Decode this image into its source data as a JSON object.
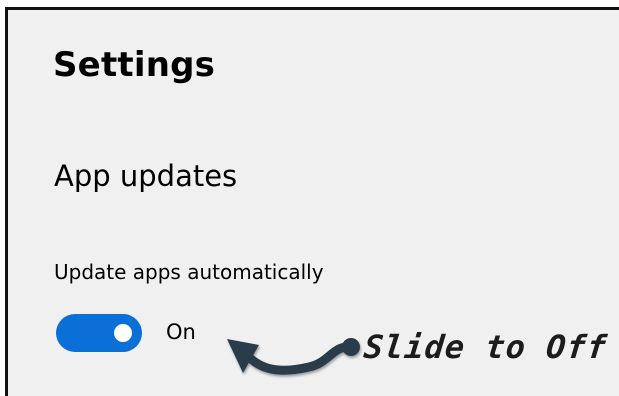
{
  "settings": {
    "title": "Settings"
  },
  "app_updates": {
    "section_title": "App updates",
    "auto_update_label": "Update apps automatically",
    "toggle_state": "On",
    "toggle_on": true,
    "toggle_color": "#0a6fd6"
  },
  "annotation": {
    "text": "Slide to Off",
    "arrow_icon": "curved-arrow-left-icon",
    "arrow_color": "#2b3a4a"
  }
}
